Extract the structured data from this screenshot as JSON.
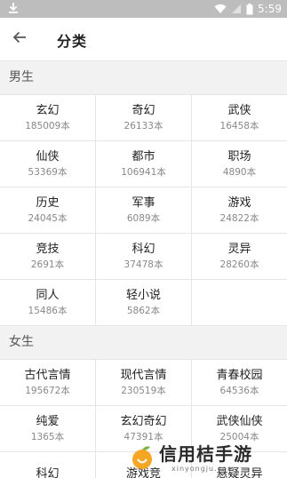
{
  "status_bar": {
    "time": "5:59",
    "icons": [
      "download-icon",
      "wifi-icon",
      "signal-icon",
      "battery-icon"
    ],
    "background": "#bdbdbd"
  },
  "app_bar": {
    "title": "分类",
    "back_icon": "arrow-left-icon"
  },
  "sections": [
    {
      "title": "男生",
      "items": [
        {
          "name": "玄幻",
          "count": "185009本"
        },
        {
          "name": "奇幻",
          "count": "26133本"
        },
        {
          "name": "武侠",
          "count": "16458本"
        },
        {
          "name": "仙侠",
          "count": "53369本"
        },
        {
          "name": "都市",
          "count": "106941本"
        },
        {
          "name": "职场",
          "count": "4890本"
        },
        {
          "name": "历史",
          "count": "24045本"
        },
        {
          "name": "军事",
          "count": "6089本"
        },
        {
          "name": "游戏",
          "count": "24822本"
        },
        {
          "name": "竞技",
          "count": "2691本"
        },
        {
          "name": "科幻",
          "count": "37478本"
        },
        {
          "name": "灵异",
          "count": "28260本"
        },
        {
          "name": "同人",
          "count": "15486本"
        },
        {
          "name": "轻小说",
          "count": "5862本"
        }
      ]
    },
    {
      "title": "女生",
      "items": [
        {
          "name": "古代言情",
          "count": "195672本"
        },
        {
          "name": "现代言情",
          "count": "230519本"
        },
        {
          "name": "青春校园",
          "count": "64536本"
        },
        {
          "name": "纯爱",
          "count": "1365本"
        },
        {
          "name": "玄幻奇幻",
          "count": "47391本"
        },
        {
          "name": "武侠仙侠",
          "count": "25004本"
        },
        {
          "name": "科幻",
          "count": ""
        },
        {
          "name": "游戏竞",
          "count": ""
        },
        {
          "name": "悬疑灵异",
          "count": ""
        }
      ]
    }
  ],
  "watermark": {
    "text": "信用桔手游",
    "sub": "xinyongju.com"
  }
}
